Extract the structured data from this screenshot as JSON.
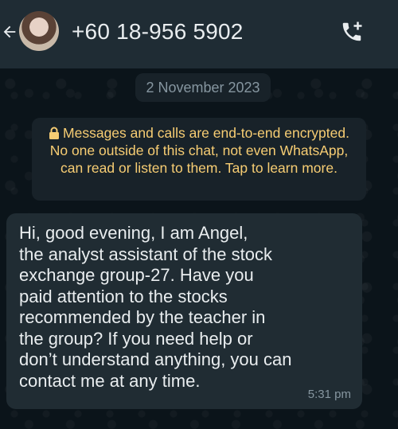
{
  "header": {
    "back_icon": "arrow-left-icon",
    "avatar_icon": "contact-avatar",
    "contact_name": "+60 18-956 5902",
    "call_icon": "add-call-icon"
  },
  "chat": {
    "date_chip": "2 November 2023",
    "encryption_notice": "Messages and calls are end-to-end encrypted. No one outside of this chat, not even WhatsApp, can read or listen to them. Tap to learn more.",
    "messages": [
      {
        "text": "Hi, good evening, I am Angel,\nthe analyst assistant of the stock\nexchange group-27. Have you\npaid attention to the stocks\nrecommended by the teacher in\nthe group? If you need help or\ndon’t understand anything, you can\ncontact me at any time.",
        "time": "5:31 pm"
      }
    ]
  },
  "colors": {
    "header_bg": "#1f2c34",
    "chat_bg": "#0b141a",
    "bubble_bg": "#202c33",
    "notice_text": "#f7cd73",
    "primary_text": "#e9edef",
    "secondary_text": "#8696a0"
  }
}
